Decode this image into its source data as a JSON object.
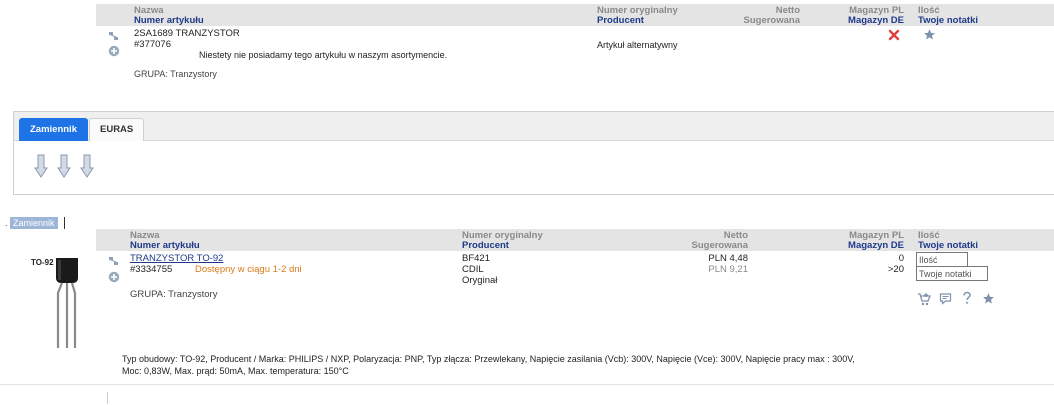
{
  "header1": {
    "col_name": "Nazwa",
    "col_article": "Numer artykułu",
    "col_orig": "Numer oryginalny",
    "col_producer": "Producent",
    "col_netto": "Netto",
    "col_suggested": "Sugerowana",
    "col_stock_pl": "Magazyn PL",
    "col_stock_de": "Magazyn DE",
    "col_qty": "Ilość",
    "col_notes": "Twoje notatki"
  },
  "item1": {
    "name": "2SA1689 TRANZYSTOR",
    "article": "#377076",
    "not_available": "Niestety nie posiadamy tego artykułu w naszym asortymencie.",
    "alt_label": "Artykuł alternatywny",
    "group": "GRUPA: Tranzystory"
  },
  "tabs": [
    {
      "label": "Zamiennik"
    },
    {
      "label": "EURAS"
    }
  ],
  "section_label": "Zamiennik",
  "header2": {
    "col_name": "Nazwa",
    "col_article": "Numer artykułu",
    "col_orig": "Numer oryginalny",
    "col_producer": "Producent",
    "col_netto": "Netto",
    "col_suggested": "Sugerowana",
    "col_stock_pl": "Magazyn PL",
    "col_stock_de": "Magazyn DE",
    "col_qty": "Ilość",
    "col_notes": "Twoje notatki"
  },
  "item2": {
    "package_label": "TO-92",
    "name": "TRANZYSTOR TO-92",
    "article": "#3334755",
    "availability": "Dostępny w ciągu 1-2 dni",
    "orig_number": "BF421",
    "producer": "CDIL",
    "original": "Oryginał",
    "price_netto": "PLN 4,48",
    "price_suggested": "PLN 9,21",
    "stock_pl": "0",
    "stock_de": ">20",
    "qty_placeholder": "Ilość",
    "notes_placeholder": "Twoje notatki",
    "group": "GRUPA: Tranzystory",
    "spec_line1": "Typ obudowy: TO-92, Producent / Marka: PHILIPS / NXP, Polaryzacja: PNP, Typ złącza: Przewlekany, Napięcie zasilania (Vcb): 300V, Napięcie (Vce): 300V, Napięcie pracy max : 300V,",
    "spec_line2": "Moc: 0,83W, Max. prąd: 50mA, Max. temperatura: 150°C"
  },
  "colors": {
    "header_bg": "#e4e4e4",
    "header_blue": "#1f3a8a",
    "tab_active": "#1e73e6",
    "availability_orange": "#d97a18",
    "remove_red": "#e04040",
    "icon_gray_blue": "#7f90aa"
  }
}
